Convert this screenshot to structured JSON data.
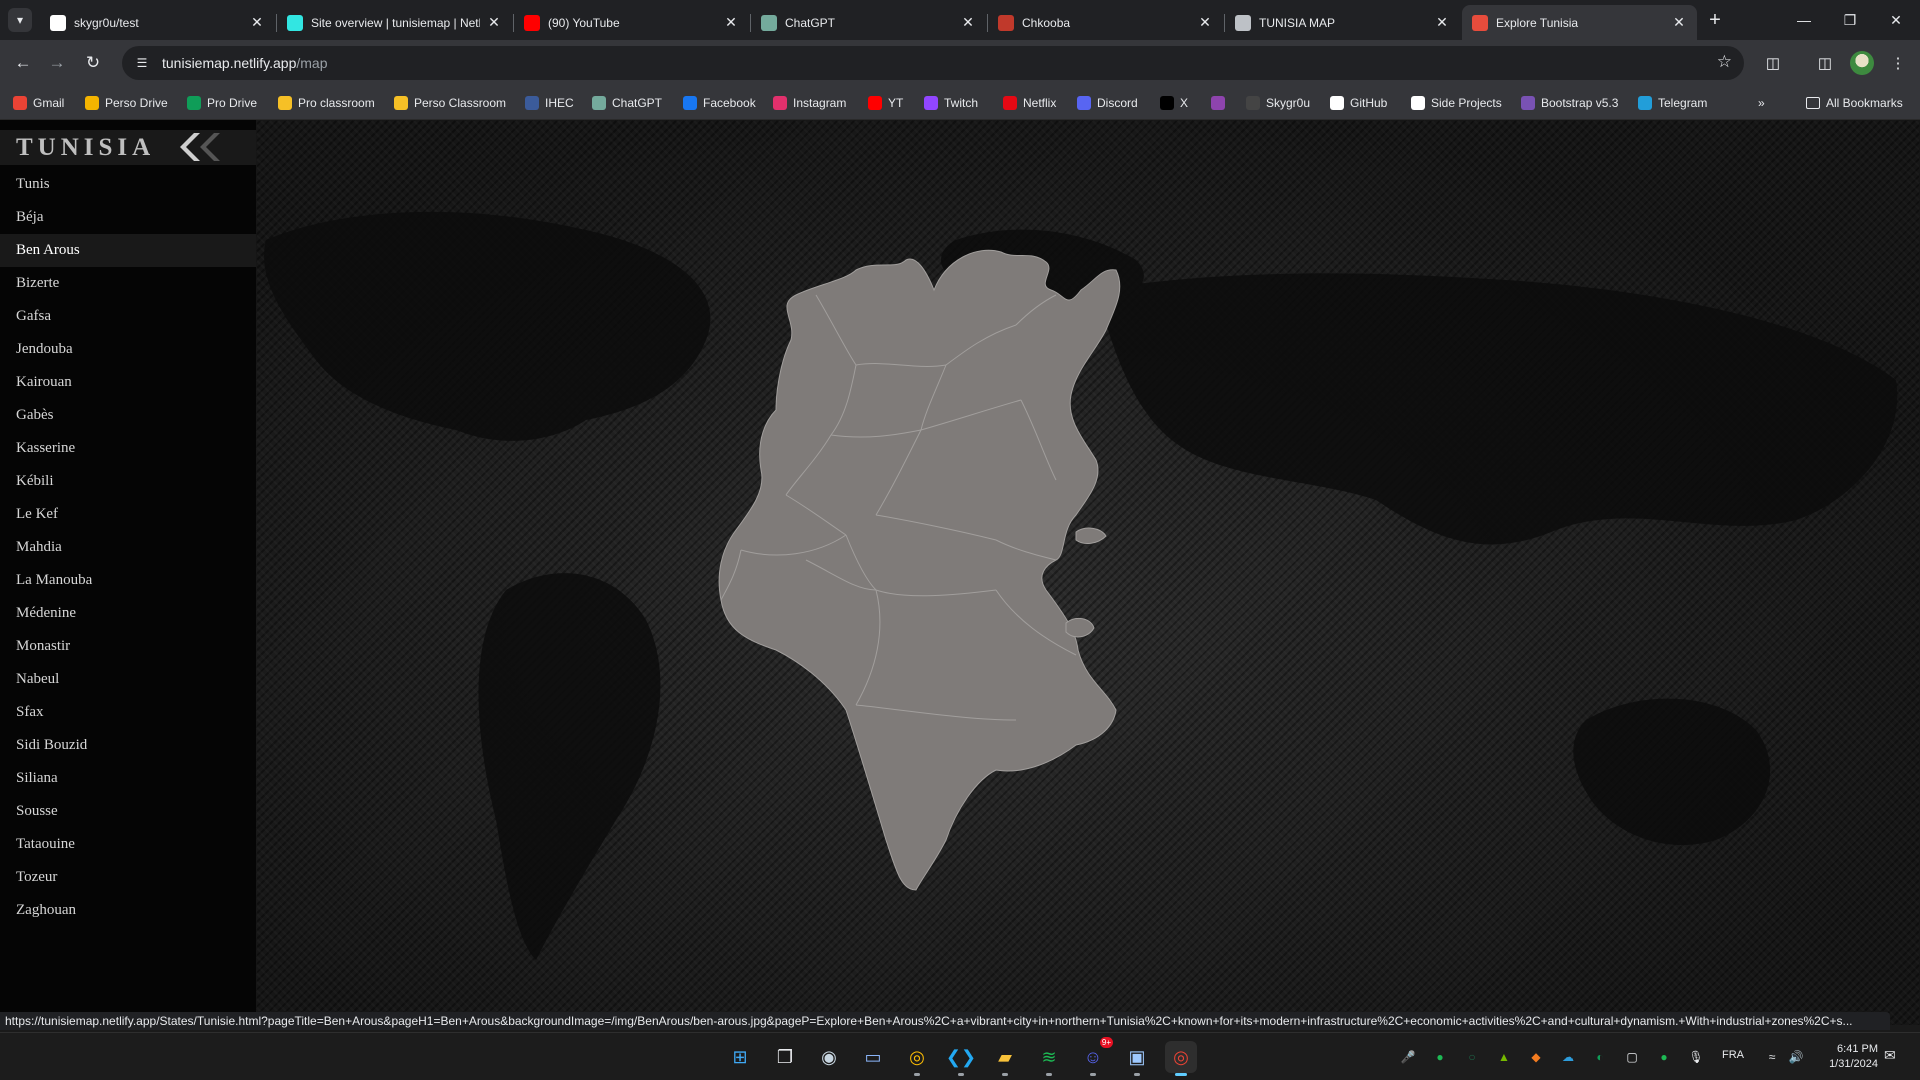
{
  "browser": {
    "tabs": [
      {
        "title": "skygr0u/test",
        "icon": "github-icon",
        "color": "#ffffff"
      },
      {
        "title": "Site overview | tunisiemap | Netlify",
        "icon": "netlify-icon",
        "color": "#32e6e2"
      },
      {
        "title": "(90) YouTube",
        "icon": "youtube-icon",
        "color": "#ff0000"
      },
      {
        "title": "ChatGPT",
        "icon": "chatgpt-icon",
        "color": "#74aa9c"
      },
      {
        "title": "Chkooba",
        "icon": "cards-icon",
        "color": "#c0392b"
      },
      {
        "title": "TUNISIA MAP",
        "icon": "globe-icon",
        "color": "#bdc1c6"
      },
      {
        "title": "Explore Tunisia",
        "icon": "explore-icon",
        "color": "#e74c3c"
      }
    ],
    "active_tab": 6,
    "url_host": "tunisiemap.netlify.app",
    "url_path": "/map",
    "bookmarks": [
      {
        "label": "Gmail",
        "icon": "gmail-icon",
        "color": "#ea4335"
      },
      {
        "label": "Perso Drive",
        "icon": "drive-icon",
        "color": "#f4b400"
      },
      {
        "label": "Pro Drive",
        "icon": "drive-icon",
        "color": "#0f9d58"
      },
      {
        "label": "Pro classroom",
        "icon": "classroom-icon",
        "color": "#f6c026"
      },
      {
        "label": "Perso Classroom",
        "icon": "classroom-icon",
        "color": "#f6c026"
      },
      {
        "label": "IHEC",
        "icon": "ihec-icon",
        "color": "#3b5b9a"
      },
      {
        "label": "ChatGPT",
        "icon": "chatgpt-icon",
        "color": "#74aa9c"
      },
      {
        "label": "Facebook",
        "icon": "facebook-icon",
        "color": "#1877f2"
      },
      {
        "label": "Instagram",
        "icon": "instagram-icon",
        "color": "#e1306c"
      },
      {
        "label": "YT",
        "icon": "youtube-icon",
        "color": "#ff0000"
      },
      {
        "label": "Twitch",
        "icon": "twitch-icon",
        "color": "#9146ff"
      },
      {
        "label": "Netflix",
        "icon": "netflix-icon",
        "color": "#e50914"
      },
      {
        "label": "Discord",
        "icon": "discord-icon",
        "color": "#5865f2"
      },
      {
        "label": "X",
        "icon": "x-icon",
        "color": "#000000"
      },
      {
        "label": "",
        "icon": "extension-icon",
        "color": "#8e44ad"
      },
      {
        "label": "Skygr0u",
        "icon": "skygr0u-icon",
        "color": "#444444"
      },
      {
        "label": "GitHub",
        "icon": "github-icon",
        "color": "#ffffff"
      },
      {
        "label": "Side Projects",
        "icon": "github-icon",
        "color": "#ffffff"
      },
      {
        "label": "Bootstrap v5.3",
        "icon": "bootstrap-icon",
        "color": "#7952b3"
      },
      {
        "label": "Telegram",
        "icon": "telegram-icon",
        "color": "#229ed9"
      }
    ],
    "more_bookmarks": "»",
    "all_bookmarks": "All Bookmarks"
  },
  "sidebar": {
    "brand": "TUNISIA",
    "governorates": [
      "Tunis",
      "Béja",
      "Ben Arous",
      "Bizerte",
      "Gafsa",
      "Jendouba",
      "Kairouan",
      "Gabès",
      "Kasserine",
      "Kébili",
      "Le Kef",
      "Mahdia",
      "La Manouba",
      "Médenine",
      "Monastir",
      "Nabeul",
      "Sfax",
      "Sidi Bouzid",
      "Siliana",
      "Sousse",
      "Tataouine",
      "Tozeur",
      "Zaghouan"
    ],
    "active_index": 2
  },
  "map": {
    "fill_color": "#7f7b79",
    "border_color": "#a19e9c",
    "background": "#141414"
  },
  "status_url": "https://tunisiemap.netlify.app/States/Tunisie.html?pageTitle=Ben+Arous&pageH1=Ben+Arous&backgroundImage=/img/BenArous/ben-arous.jpg&pageP=Explore+Ben+Arous%2C+a+vibrant+city+in+northern+Tunisia%2C+known+for+its+modern+infrastructure%2C+economic+activities%2C+and+cultural+dynamism.+With+industrial+zones%2C+s...",
  "taskbar": {
    "apps": [
      {
        "name": "start-button",
        "icon": "windows-icon",
        "color": "#3fa9f5"
      },
      {
        "name": "task-view-button",
        "icon": "task-view-icon",
        "color": "#e8eaed"
      },
      {
        "name": "taskbar-steam",
        "icon": "steam-icon",
        "color": "#c7d5e0"
      },
      {
        "name": "taskbar-app-4",
        "icon": "app-icon",
        "color": "#8ab4f8"
      },
      {
        "name": "taskbar-chrome",
        "icon": "chrome-icon",
        "color": "#fbbc04"
      },
      {
        "name": "taskbar-vscode",
        "icon": "vscode-icon",
        "color": "#23a9f2"
      },
      {
        "name": "taskbar-file-explorer",
        "icon": "folder-icon",
        "color": "#f8c23a"
      },
      {
        "name": "taskbar-spotify",
        "icon": "spotify-icon",
        "color": "#1db954"
      },
      {
        "name": "taskbar-discord",
        "icon": "discord-icon",
        "color": "#5865f2"
      },
      {
        "name": "taskbar-photos",
        "icon": "photos-icon",
        "color": "#9ec9ff"
      },
      {
        "name": "taskbar-chrome-active",
        "icon": "chrome-icon",
        "color": "#ea4335"
      }
    ],
    "discord_badge": "9+",
    "tray": [
      "mic-off-icon",
      "spotify-icon",
      "tray-app-icon",
      "nvidia-icon",
      "app-orange-icon",
      "cloud-icon",
      "edge-icon",
      "tablet-icon",
      "green-app-icon",
      "microphone-icon"
    ],
    "language": "FRA",
    "time": "6:41 PM",
    "date": "1/31/2024"
  }
}
